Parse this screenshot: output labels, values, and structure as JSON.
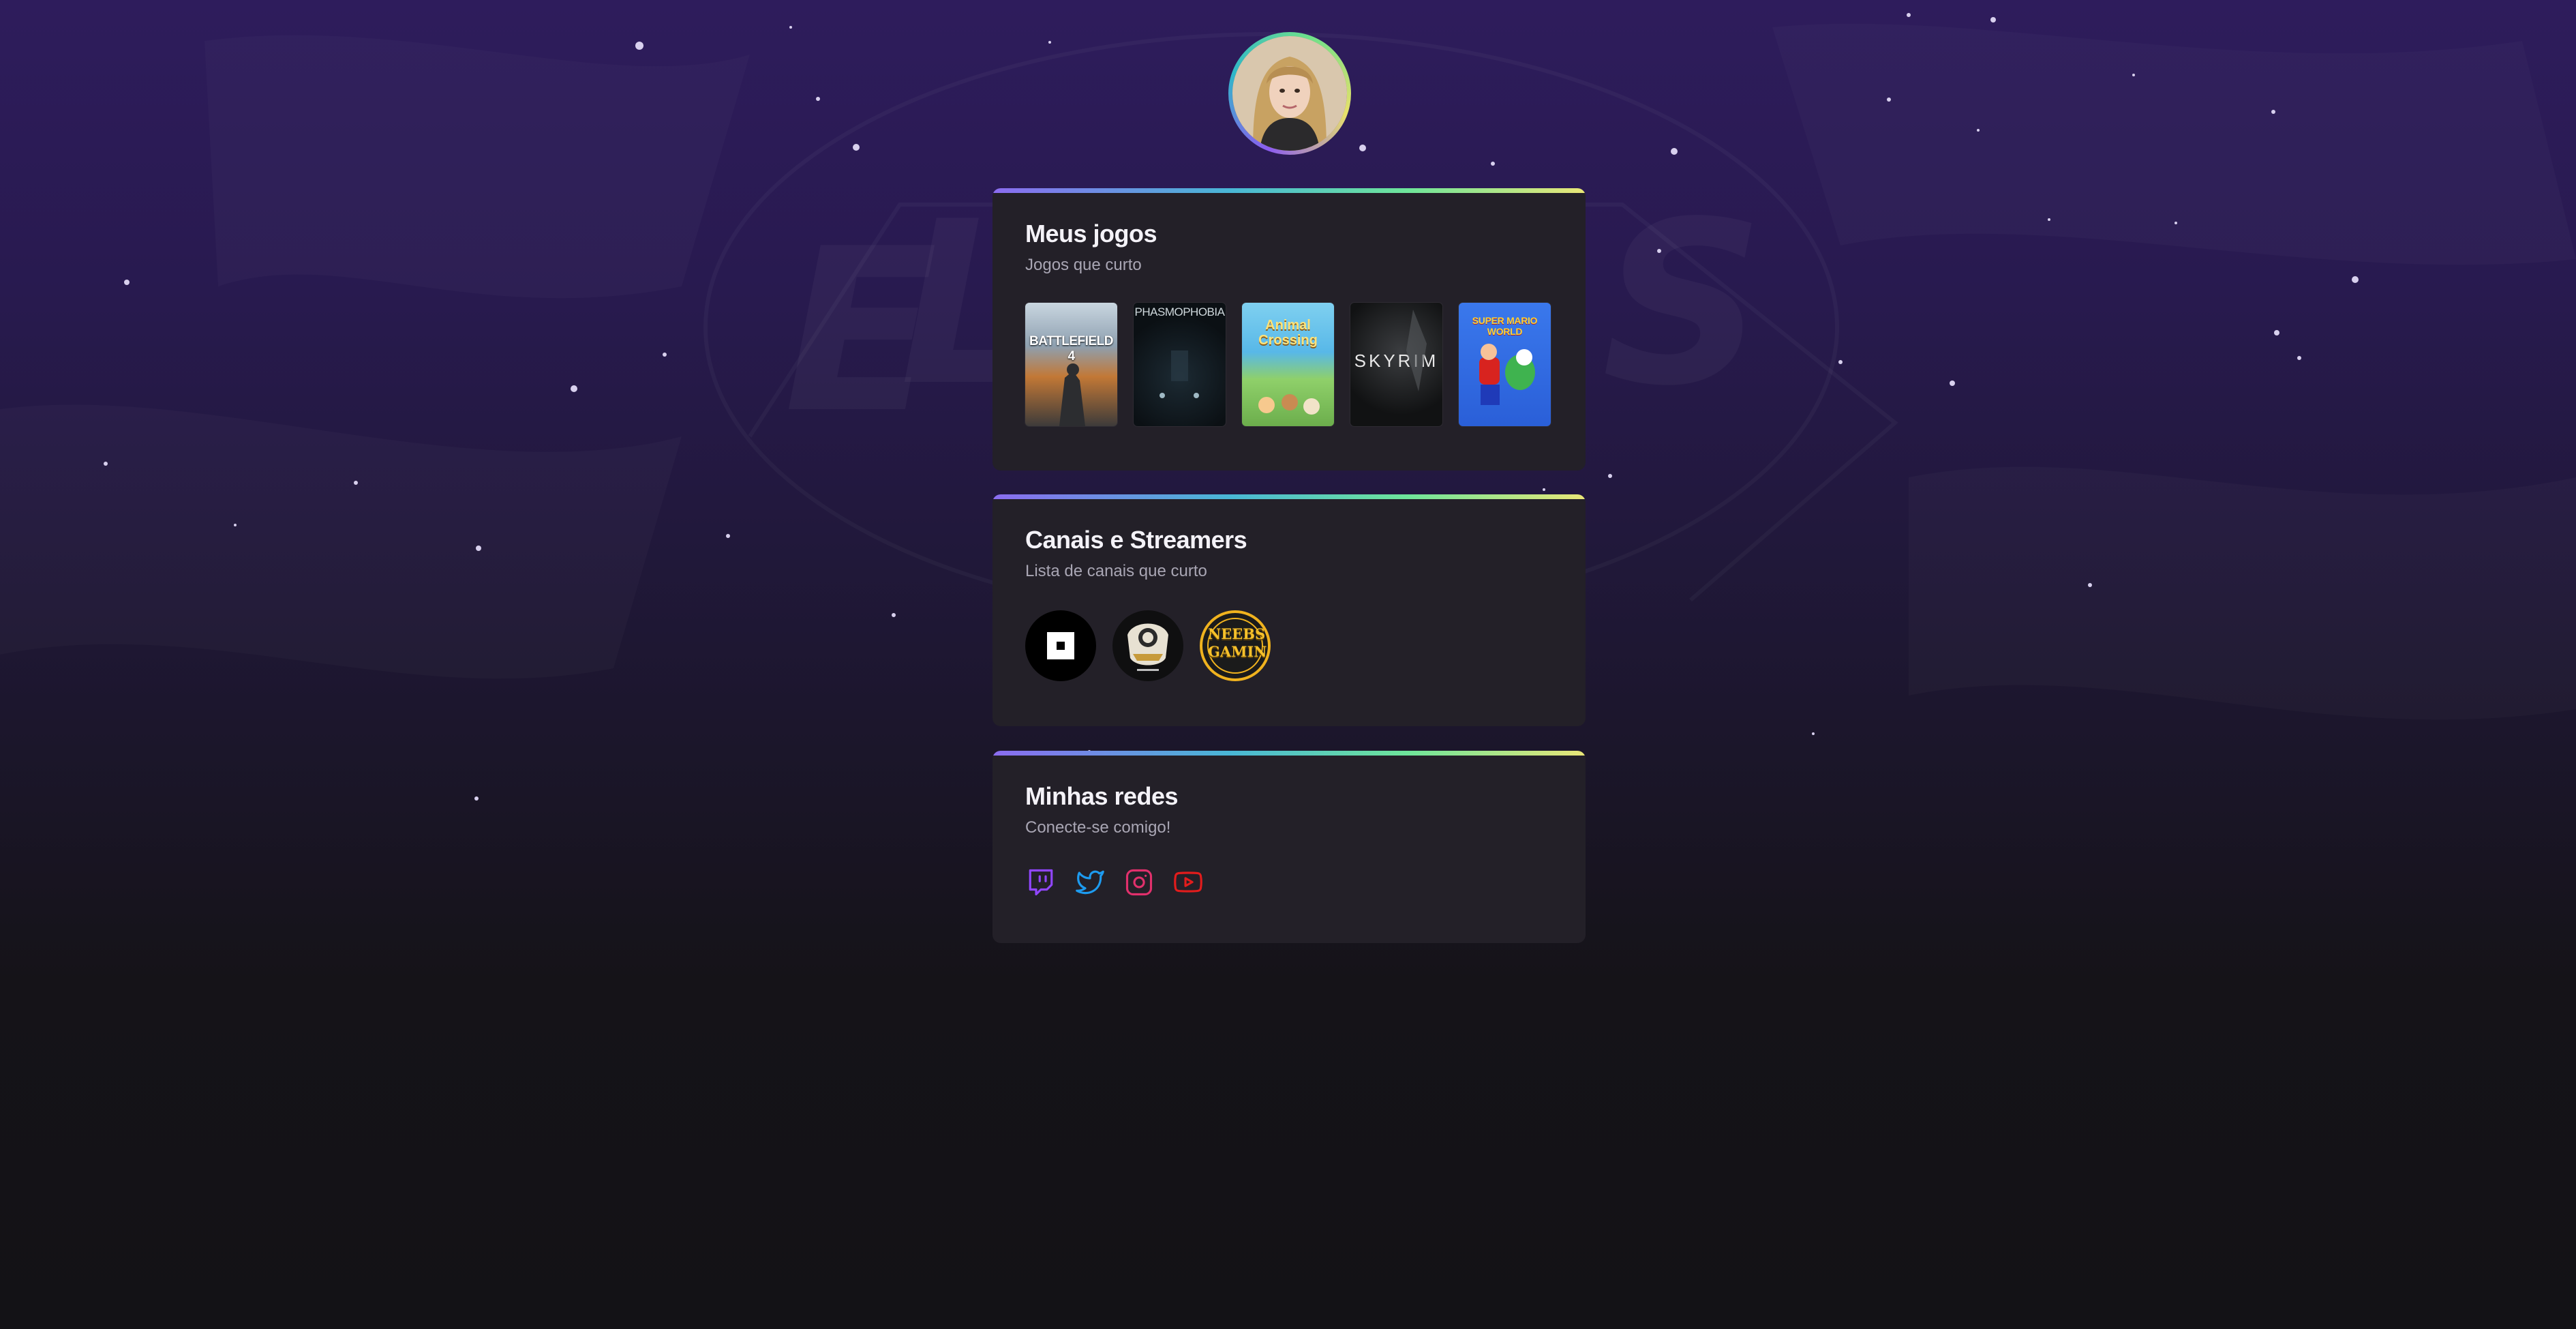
{
  "profile": {
    "avatar_icon": "avatar-photo"
  },
  "games_section": {
    "title": "Meus jogos",
    "subtitle": "Jogos que curto",
    "games": [
      {
        "name": "BATTLEFIELD 4",
        "cover_color": "#9fb3c4"
      },
      {
        "name": "PHASMOPHOBIA",
        "cover_color": "#0f1519"
      },
      {
        "name": "Animal Crossing",
        "cover_color": "#58b8e8"
      },
      {
        "name": "SKYRIM",
        "cover_color": "#0b0b0c"
      },
      {
        "name": "SUPER MARIO WORLD",
        "cover_color": "#2a5fd8"
      }
    ]
  },
  "channels_section": {
    "title": "Canais e Streamers",
    "subtitle": "Lista de canais que curto",
    "channels": [
      {
        "icon": "square-logo-icon"
      },
      {
        "icon": "crest-logo-icon"
      },
      {
        "label": "NEEBS GAMING",
        "icon": "neebs-gaming-logo-icon"
      }
    ]
  },
  "socials_section": {
    "title": "Minhas redes",
    "subtitle": "Conecte-se comigo!",
    "links": [
      {
        "icon": "twitch-icon",
        "color": "#9146ff"
      },
      {
        "icon": "twitter-icon",
        "color": "#1d9bf0"
      },
      {
        "icon": "instagram-icon",
        "color": "#e1306c"
      },
      {
        "icon": "youtube-icon",
        "color": "#e21c1c"
      }
    ]
  }
}
